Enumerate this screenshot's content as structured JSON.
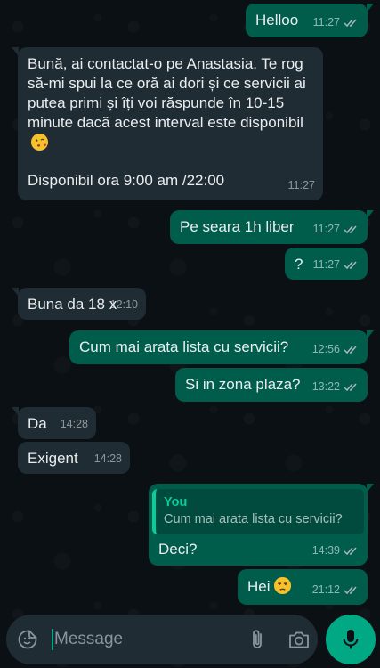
{
  "messages": [
    {
      "id": "m1",
      "dir": "out",
      "text": "Helloo",
      "time": "11:27",
      "read": true
    },
    {
      "id": "m2",
      "dir": "in",
      "text": "Bună, ai contactat-o pe Anastasia. Te rog să-mi spui la ce oră ai dori și ce servicii ai putea primi și îți voi răspunde în 10-15 minute dacă acest interval este disponibil",
      "emoji": "face-blowing-kiss",
      "text2": "Disponibil ora 9:00 am /22:00",
      "time": "11:27"
    },
    {
      "id": "m3",
      "dir": "out",
      "text": "Pe seara 1h liber",
      "time": "11:27",
      "read": true
    },
    {
      "id": "m4",
      "dir": "out",
      "text": "?",
      "time": "11:27",
      "read": true
    },
    {
      "id": "m5",
      "dir": "in",
      "text": "Buna da 18 x",
      "time": "12:10"
    },
    {
      "id": "m6",
      "dir": "out",
      "text": "Cum mai arata lista cu servicii?",
      "time": "12:56",
      "read": true
    },
    {
      "id": "m7",
      "dir": "out",
      "text": "Si in zona plaza?",
      "time": "13:22",
      "read": true
    },
    {
      "id": "m8",
      "dir": "in",
      "text": "Da",
      "time": "14:28"
    },
    {
      "id": "m9",
      "dir": "in",
      "text": "Exigent",
      "time": "14:28"
    },
    {
      "id": "m10",
      "dir": "out",
      "quote_author": "You",
      "quote_text": "Cum mai arata lista cu servicii?",
      "text": "Deci?",
      "time": "14:39",
      "read": true
    },
    {
      "id": "m11",
      "dir": "out",
      "text": "Hei",
      "emoji": "unamused-face",
      "time": "21:12",
      "read": true
    }
  ],
  "composer": {
    "placeholder": "Message",
    "emoji_icon": "sticker-smile-icon",
    "attach_icon": "paperclip-icon",
    "camera_icon": "camera-icon",
    "mic_icon": "microphone-icon"
  },
  "colors": {
    "background": "#0b1014",
    "outgoing_bubble": "#005c4b",
    "incoming_bubble": "#202c33",
    "accent": "#00a884",
    "read_ticks": "#53bdeb"
  }
}
